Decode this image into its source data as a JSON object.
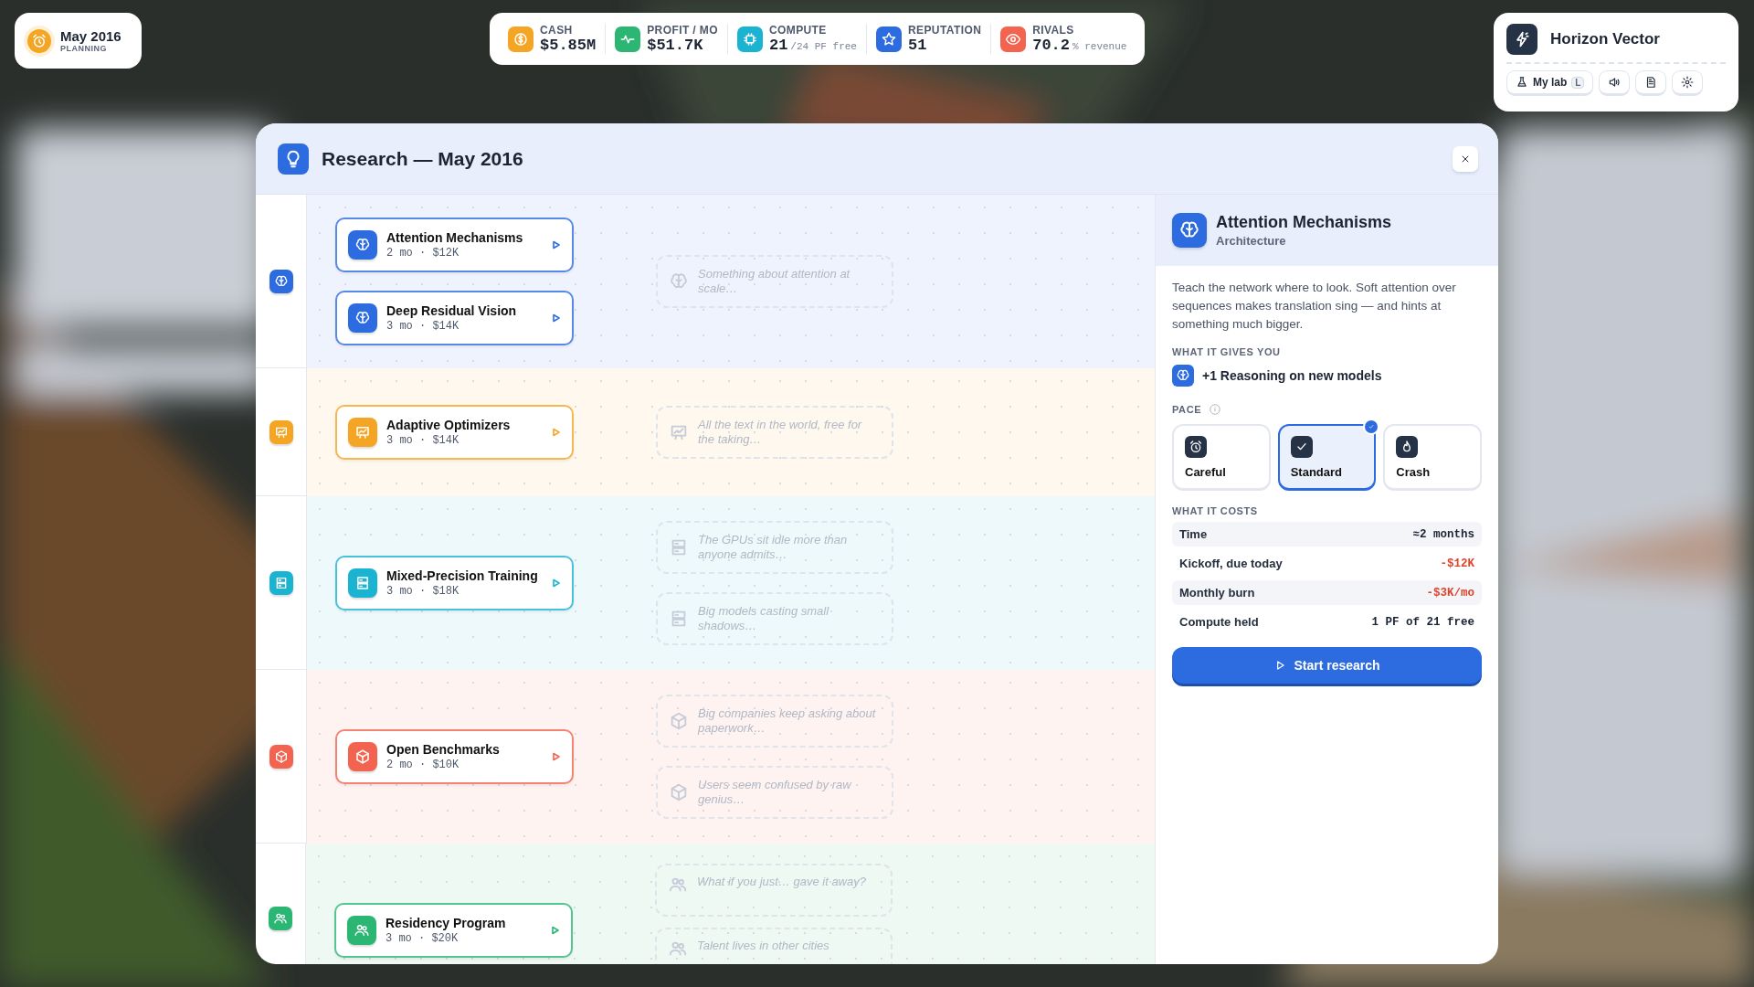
{
  "date_badge": {
    "date": "May 2016",
    "phase": "PLANNING"
  },
  "stats": [
    {
      "label": "CASH",
      "value": "$5.85M",
      "kind": "coin",
      "color": "#f5a524"
    },
    {
      "label": "PROFIT / MO",
      "value": "$51.7K",
      "kind": "pulse",
      "color": "#2bb673"
    },
    {
      "label": "COMPUTE",
      "value": "21",
      "suffix": "/24 PF free",
      "kind": "chip",
      "color": "#1ab3d1"
    },
    {
      "label": "REPUTATION",
      "value": "51",
      "kind": "star",
      "color": "#2d6be0"
    },
    {
      "label": "RIVALS",
      "value": "70.2",
      "suffix": "% revenue",
      "kind": "eye",
      "color": "#f2644f"
    }
  ],
  "company": {
    "name": "Horizon Vector",
    "buttons": [
      {
        "kind": "lab",
        "label": "My lab",
        "shortcut": "L"
      },
      {
        "kind": "sound"
      },
      {
        "kind": "notes"
      },
      {
        "kind": "settings"
      }
    ]
  },
  "modal": {
    "title": "Research — May 2016",
    "lanes": [
      {
        "kind": "brain",
        "color": "#2d6be0",
        "projects": [
          {
            "title": "Attention Mechanisms",
            "meta": "2 mo · $12K"
          },
          {
            "title": "Deep Residual Vision",
            "meta": "3 mo · $14K"
          }
        ],
        "mysteries": [
          "Something about attention at scale…"
        ]
      },
      {
        "kind": "chart",
        "color": "#f5a524",
        "projects": [
          {
            "title": "Adaptive Optimizers",
            "meta": "3 mo · $14K"
          }
        ],
        "mysteries": [
          "All the text in the world, free for the taking…"
        ]
      },
      {
        "kind": "server",
        "color": "#1ab3d1",
        "projects": [
          {
            "title": "Mixed-Precision Training",
            "meta": "3 mo · $18K"
          }
        ],
        "mysteries": [
          "The GPUs sit idle more than anyone admits…",
          "Big models casting small shadows…"
        ]
      },
      {
        "kind": "cube",
        "color": "#f2644f",
        "projects": [
          {
            "title": "Open Benchmarks",
            "meta": "2 mo · $10K"
          }
        ],
        "mysteries": [
          "Big companies keep asking about paperwork…",
          "Users seem confused by raw genius…"
        ]
      },
      {
        "kind": "people",
        "color": "#2bb673",
        "projects": [
          {
            "title": "Residency Program",
            "meta": "3 mo · $20K"
          }
        ],
        "mysteries": [
          "What if you just… gave it away?",
          "Talent lives in other cities"
        ]
      }
    ]
  },
  "detail": {
    "title": "Attention Mechanisms",
    "category": "Architecture",
    "kind": "brain",
    "color": "#2d6be0",
    "description": "Teach the network where to look. Soft attention over sequences makes translation sing — and hints at something much bigger.",
    "gives_heading": "WHAT IT GIVES YOU",
    "gives": [
      {
        "kind": "brain",
        "text": "+1 Reasoning on new models"
      }
    ],
    "pace_heading": "PACE",
    "pace": [
      {
        "label": "Careful",
        "kind": "alarm",
        "selected": false
      },
      {
        "label": "Standard",
        "kind": "check",
        "selected": true
      },
      {
        "label": "Crash",
        "kind": "flame",
        "selected": false
      }
    ],
    "costs_heading": "WHAT IT COSTS",
    "costs": [
      {
        "label": "Time",
        "value": "≈2 months",
        "negative": false
      },
      {
        "label": "Kickoff, due today",
        "value": "-$12K",
        "negative": true
      },
      {
        "label": "Monthly burn",
        "value": "-$3K/mo",
        "negative": true
      },
      {
        "label": "Compute held",
        "value": "1 PF of 21 free",
        "negative": false
      }
    ],
    "action": "Start research"
  }
}
